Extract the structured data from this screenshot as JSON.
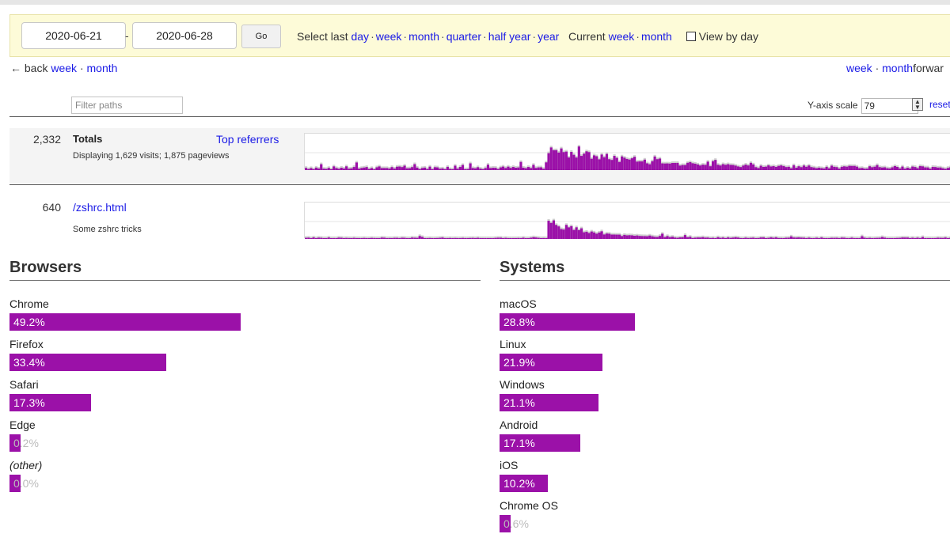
{
  "filters": {
    "start_date": "2020-06-21",
    "end_date": "2020-06-28",
    "go_label": "Go",
    "select_last_label": "Select last",
    "select_last": [
      "day",
      "week",
      "month",
      "quarter",
      "half year",
      "year"
    ],
    "current_label": "Current",
    "current": [
      "week",
      "month"
    ],
    "view_by_day_label": "View by day",
    "view_by_day_checked": false
  },
  "nav": {
    "back_label": "← back",
    "back_week": "week",
    "back_month": "month",
    "forward_week": "week",
    "forward_month": "month",
    "forward_label": "forwar"
  },
  "path_filter": {
    "placeholder": "Filter paths"
  },
  "yscale": {
    "label": "Y-axis scale",
    "value": "79",
    "reset_label": "reset"
  },
  "totals": {
    "count": "2,332",
    "label": "Totals",
    "display_text": "Displaying 1,629 visits; 1,875 pageviews",
    "top_referrers_label": "Top referrers"
  },
  "pages": [
    {
      "count": "640",
      "path": "/zshrc.html",
      "description": "Some zshrc tricks"
    }
  ],
  "browsers": {
    "title": "Browsers",
    "items": [
      {
        "name": "Chrome",
        "pct": "49.2%",
        "value": 49.2,
        "italic": false
      },
      {
        "name": "Firefox",
        "pct": "33.4%",
        "value": 33.4,
        "italic": false
      },
      {
        "name": "Safari",
        "pct": "17.3%",
        "value": 17.3,
        "italic": false
      },
      {
        "name": "Edge",
        "pct": "0.2%",
        "value": 0.2,
        "italic": false
      },
      {
        "name": "(other)",
        "pct": "0.0%",
        "value": 0.0,
        "italic": true
      }
    ]
  },
  "systems": {
    "title": "Systems",
    "items": [
      {
        "name": "macOS",
        "pct": "28.8%",
        "value": 28.8
      },
      {
        "name": "Linux",
        "pct": "21.9%",
        "value": 21.9
      },
      {
        "name": "Windows",
        "pct": "21.1%",
        "value": 21.1
      },
      {
        "name": "Android",
        "pct": "17.1%",
        "value": 17.1
      },
      {
        "name": "iOS",
        "pct": "10.2%",
        "value": 10.2
      },
      {
        "name": "Chrome OS",
        "pct": "0.6%",
        "value": 0.6
      }
    ]
  },
  "colors": {
    "accent": "#9b11a8",
    "link": "#1a1ae6",
    "filterbar_bg": "#fdfbd8"
  }
}
